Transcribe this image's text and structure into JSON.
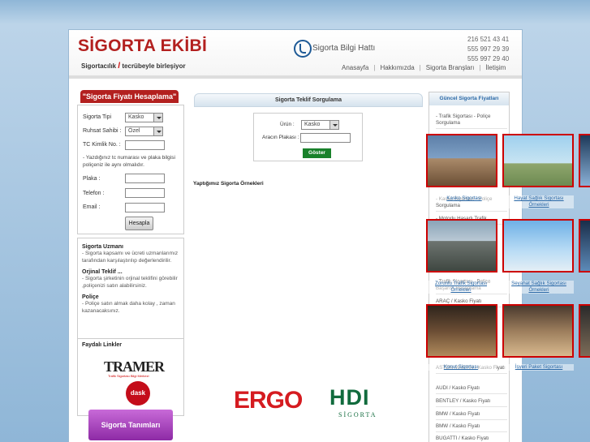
{
  "header": {
    "logo": "SİGORTA EKİBİ",
    "tagline_a": "Sigortacılık",
    "tagline_slash": "/",
    "tagline_b": "tecrübeyle birleşiyor",
    "hotline": "Sigorta Bilgi Hattı",
    "phones": [
      "216 521 43 41",
      "555 997 29 39",
      "555 997 29 40"
    ],
    "nav": [
      "Anasayfa",
      "Hakkımızda",
      "Sigorta Branşları",
      "İletişim"
    ]
  },
  "calc": {
    "title": "\"Sigorta Fiyatı Hesaplama\"",
    "tip_label": "Sigorta Tipi",
    "tip_value": "Kasko",
    "ruhsat_label": "Ruhsat Sahibi :",
    "ruhsat_value": "Özel",
    "tc_label": "TC Kimlik No. :",
    "note": "- Yazdığınız tc numarası ve plaka bilgisi poliçeniz ile aynı olmalıdır.",
    "plaka_label": "Plaka :",
    "telefon_label": "Telefon :",
    "email_label": "Email :",
    "button": "Hesapla"
  },
  "info": [
    {
      "title": "Sigorta Uzmanı",
      "text": "- Sigorta kapsamı ve ücreti uzmanlarımız tarafından karşılaştırılıp değerlendirilir."
    },
    {
      "title": "Orjinal Teklif ...",
      "text": "- Sigorta şirketinin orjinal teklifini görebilir ,poliçenizi satın alabilirsiniz."
    },
    {
      "title": "Poliçe",
      "text": "- Poliçe satın almak daha kolay , zaman kazanacaksınız."
    }
  ],
  "links": {
    "title": "Faydalı Linkler",
    "tramer": "TRAMER",
    "tramer_sub": "Trafik Sigortası Bilgi Merkezi",
    "dask": "dask"
  },
  "tanim": "Sigorta Tanımları",
  "center": {
    "title": "Sigorta Teklif Sorgulama",
    "urun_label": "Ürün :",
    "urun_value": "Kasko",
    "plaka_label": "Aracın Plakası :",
    "button": "Göster",
    "ornek": "Yaptığımız Sigorta Örnekleri"
  },
  "brands": {
    "ergo": "ERGO",
    "hdi": "HDI",
    "hdi_sub": "SİGORTA"
  },
  "right": {
    "title": "Güncel Sigorta Fiyatları",
    "items": [
      "- Trafik Sigortası - Poliçe Sorgulama",
      "- Kasko Sigortası - Poliçe Sorgulama",
      "- Motorlu Hasarlı Trafik",
      "- Trafik Sigortası - Poliçe Başarısı Hesaplama",
      "ARAÇ / Kasko Fiyatı",
      "ASTON MARTIN / Kasko Fiyatı",
      "AUDI / Kasko Fiyatı",
      "BENTLEY / Kasko Fiyatı",
      "BMW / Kasko Fiyatı",
      "BMW / Kasko Fiyatı",
      "BUGATTI / Kasko Fiyatı"
    ]
  },
  "samples": [
    {
      "caption": "Kasko Sigortası"
    },
    {
      "caption": "Hayat Sağlık Sigortası Örnekleri"
    },
    {
      "caption": "Zorunlu Trafik Sigortası Örnekleri"
    },
    {
      "caption": "Seyahat Sağlık Sigortası Örnekleri"
    },
    {
      "caption": "Konut Sigortası"
    },
    {
      "caption": "İşyeri Paket Sigortası"
    }
  ]
}
